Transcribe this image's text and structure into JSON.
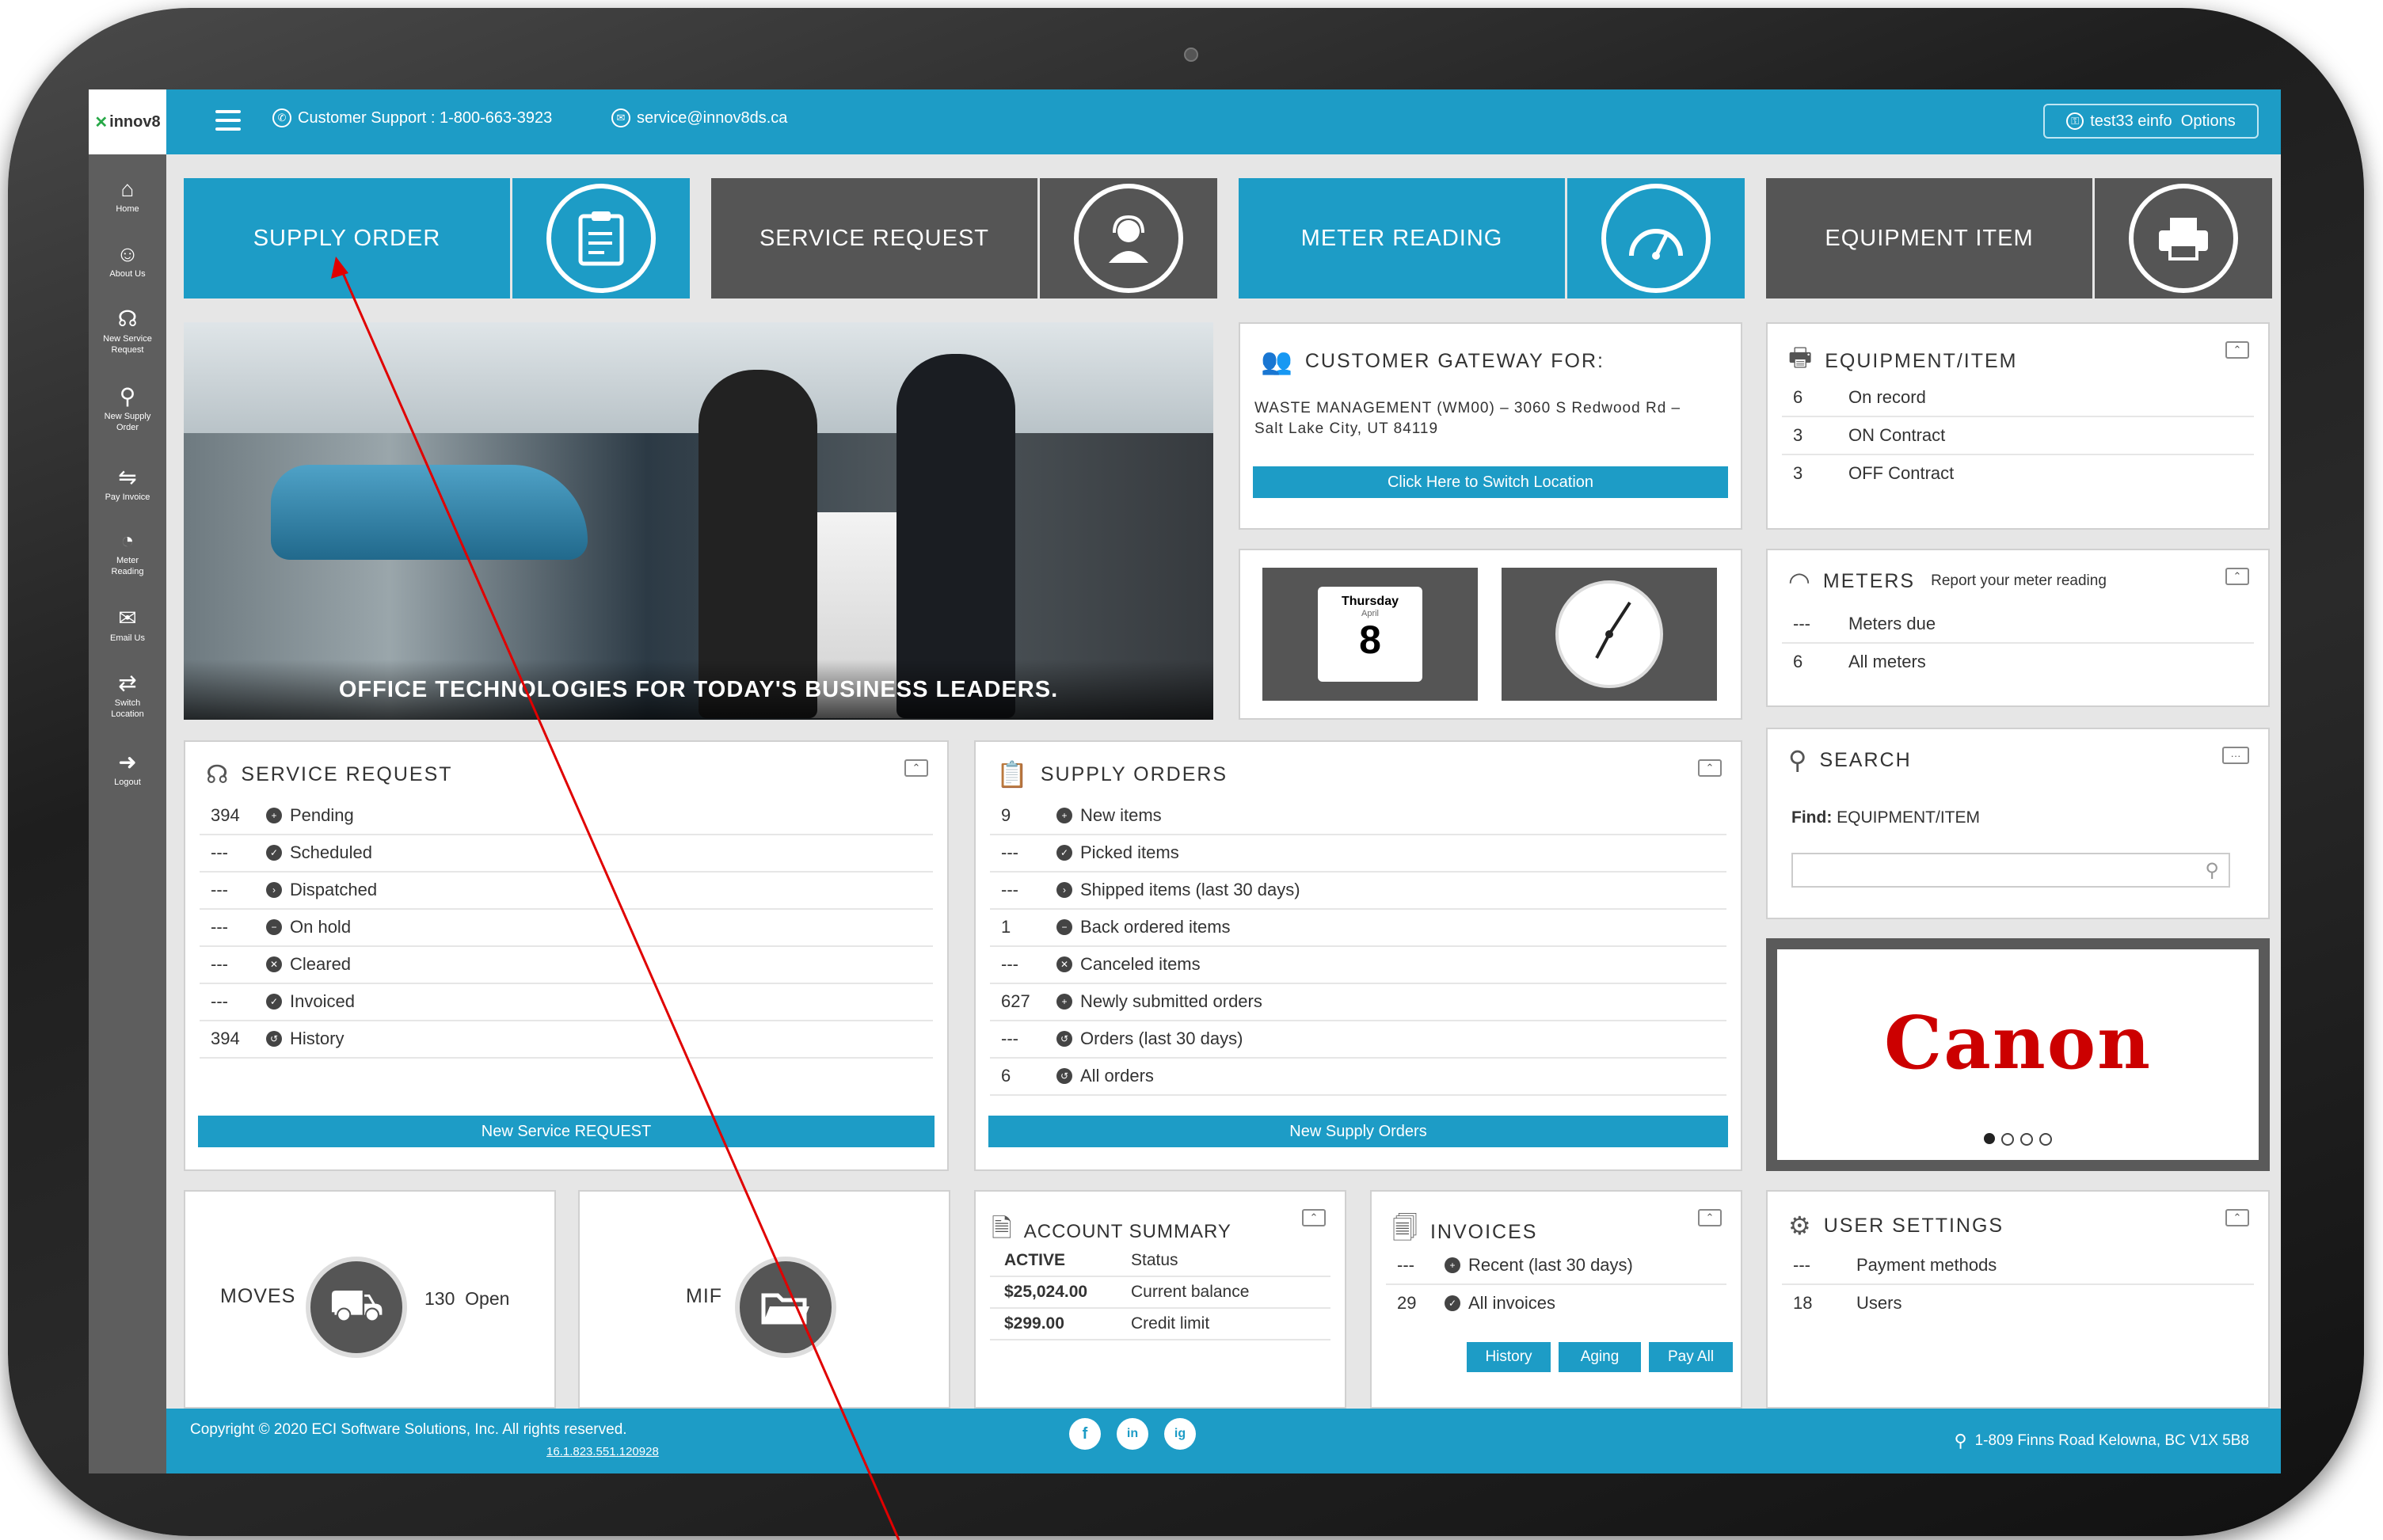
{
  "topbar": {
    "logo_text": "innov8",
    "support_label": "Customer Support : 1-800-663-3923",
    "email": "service@innov8ds.ca",
    "user_label": "test33 einfo",
    "options_label": "Options"
  },
  "sidebar": {
    "items": [
      {
        "label_1": "Home",
        "label_2": "",
        "icon": "home-icon"
      },
      {
        "label_1": "About Us",
        "label_2": "",
        "icon": "user-icon"
      },
      {
        "label_1": "New Service",
        "label_2": "Request",
        "icon": "headset-icon"
      },
      {
        "label_1": "New Supply",
        "label_2": "Order",
        "icon": "supply-icon"
      },
      {
        "label_1": "Pay Invoice",
        "label_2": "",
        "icon": "handshake-icon"
      },
      {
        "label_1": "Meter",
        "label_2": "Reading",
        "icon": "meter-icon"
      },
      {
        "label_1": "Email Us",
        "label_2": "",
        "icon": "envelope-icon"
      },
      {
        "label_1": "Switch",
        "label_2": "Location",
        "icon": "switch-icon"
      },
      {
        "label_1": "Logout",
        "label_2": "",
        "icon": "logout-icon"
      }
    ]
  },
  "tiles": {
    "supply_order": "SUPPLY ORDER",
    "service_request": "SERVICE REQUEST",
    "meter_reading": "METER READING",
    "equipment_item": "EQUIPMENT ITEM"
  },
  "hero": {
    "caption": "OFFICE TECHNOLOGIES FOR TODAY'S BUSINESS LEADERS."
  },
  "gateway": {
    "title": "CUSTOMER GATEWAY FOR:",
    "address_line1": "WASTE MANAGEMENT (WM00) – 3060 S Redwood Rd –",
    "address_line2": "Salt Lake City, UT 84119",
    "switch_button": "Click Here to Switch Location"
  },
  "calendar": {
    "day_name": "Thursday",
    "month": "April",
    "day": "8"
  },
  "equipment": {
    "title": "EQUIPMENT/ITEM",
    "rows": [
      {
        "count": "6",
        "label": "On record"
      },
      {
        "count": "3",
        "label": "ON Contract"
      },
      {
        "count": "3",
        "label": "OFF Contract"
      }
    ]
  },
  "meters": {
    "title": "METERS",
    "subtitle": "Report your meter reading",
    "rows": [
      {
        "count": "---",
        "label": "Meters due"
      },
      {
        "count": "6",
        "label": "All meters"
      }
    ]
  },
  "service_request": {
    "title": "SERVICE REQUEST",
    "rows": [
      {
        "count": "394",
        "label": "Pending"
      },
      {
        "count": "---",
        "label": "Scheduled"
      },
      {
        "count": "---",
        "label": "Dispatched"
      },
      {
        "count": "---",
        "label": "On hold"
      },
      {
        "count": "---",
        "label": "Cleared"
      },
      {
        "count": "---",
        "label": "Invoiced"
      },
      {
        "count": "394",
        "label": "History"
      }
    ],
    "button": "New Service REQUEST"
  },
  "supply_orders": {
    "title": "SUPPLY ORDERS",
    "rows": [
      {
        "count": "9",
        "label": "New items"
      },
      {
        "count": "---",
        "label": "Picked items"
      },
      {
        "count": "---",
        "label": "Shipped items (last 30 days)"
      },
      {
        "count": "1",
        "label": "Back ordered items"
      },
      {
        "count": "---",
        "label": "Canceled items"
      },
      {
        "count": "627",
        "label": "Newly submitted orders"
      },
      {
        "count": "---",
        "label": "Orders (last 30 days)"
      },
      {
        "count": "6",
        "label": "All orders"
      }
    ],
    "button": "New Supply Orders"
  },
  "search": {
    "title": "SEARCH",
    "find_label": "Find:",
    "find_value": "EQUIPMENT/ITEM",
    "placeholder": ""
  },
  "brand_carousel": {
    "brand": "Canon",
    "dots": [
      "active",
      "",
      "",
      ""
    ]
  },
  "moves": {
    "label": "MOVES",
    "count": "130",
    "status": "Open"
  },
  "mif": {
    "label": "MIF"
  },
  "account_summary": {
    "title": "ACCOUNT SUMMARY",
    "rows": [
      {
        "value": "ACTIVE",
        "label": "Status"
      },
      {
        "value": "$25,024.00",
        "label": "Current balance"
      },
      {
        "value": "$299.00",
        "label": "Credit limit"
      }
    ]
  },
  "invoices": {
    "title": "INVOICES",
    "rows": [
      {
        "count": "---",
        "label": "Recent (last 30 days)"
      },
      {
        "count": "29",
        "label": "All invoices"
      }
    ],
    "buttons": {
      "history": "History",
      "aging": "Aging",
      "pay_all": "Pay All"
    }
  },
  "user_settings": {
    "title": "USER SETTINGS",
    "rows": [
      {
        "count": "---",
        "label": "Payment methods"
      },
      {
        "count": "18",
        "label": "Users"
      }
    ]
  },
  "footer": {
    "copyright": "Copyright © 2020 ECI Software Solutions, Inc. All rights reserved.",
    "version": "16.1.823.551.120928",
    "address": "1-809 Finns Road Kelowna, BC V1X 5B8",
    "social": [
      "f",
      "in",
      "ig"
    ]
  },
  "colors": {
    "primary": "#1d9cc6",
    "dark": "#555555",
    "annotation": "#e00000",
    "canon_red": "#cc0000"
  }
}
